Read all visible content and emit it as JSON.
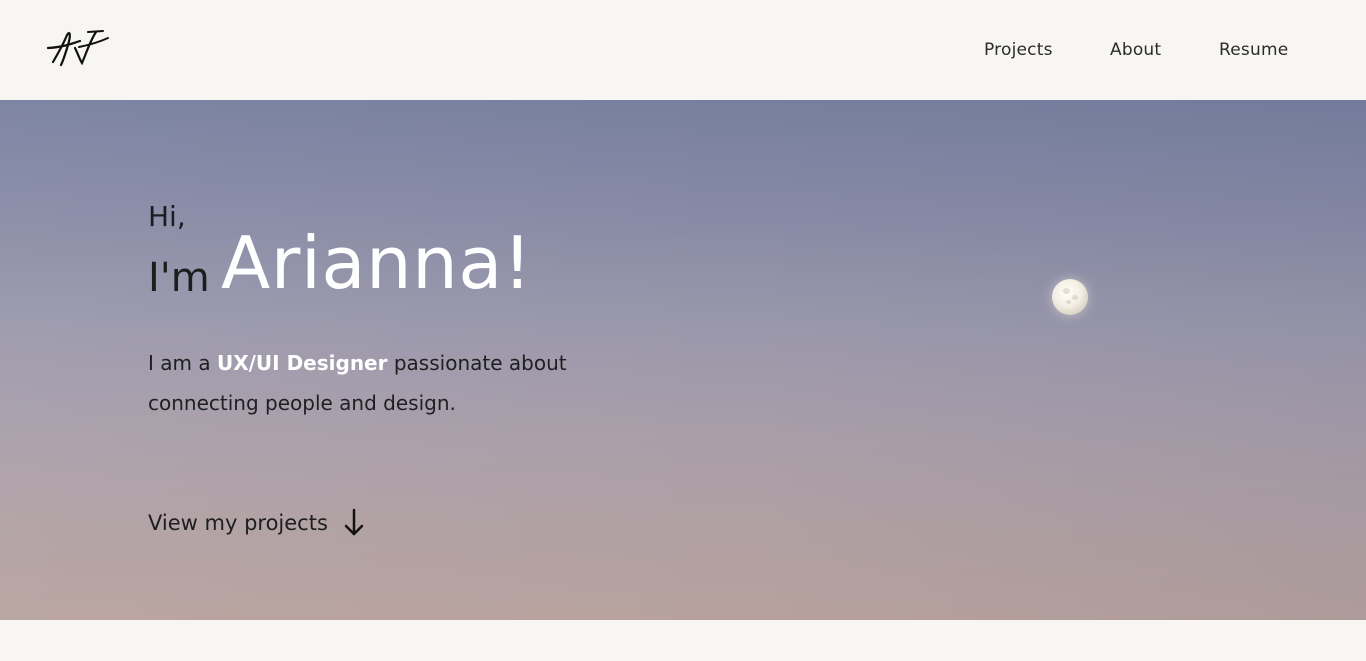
{
  "header": {
    "logo": {
      "icon": "signature-logo-icon"
    },
    "nav": {
      "projects": "Projects",
      "about": "About",
      "resume": "Resume"
    }
  },
  "hero": {
    "greeting": "Hi,",
    "im": "I'm",
    "name": "Arianna!",
    "description": {
      "prefix": "I am a",
      "role": "UX/UI Designer",
      "suffix": "passionate about connecting people and design."
    },
    "cta": {
      "label": "View my projects",
      "icon": "arrow-down-icon"
    },
    "background": {
      "top_color": "#777f9f",
      "bottom_color": "#b7a19d"
    }
  },
  "colors": {
    "background": "#f7f6f2",
    "text": "#1d1d1f",
    "accent": "#ffffff"
  }
}
